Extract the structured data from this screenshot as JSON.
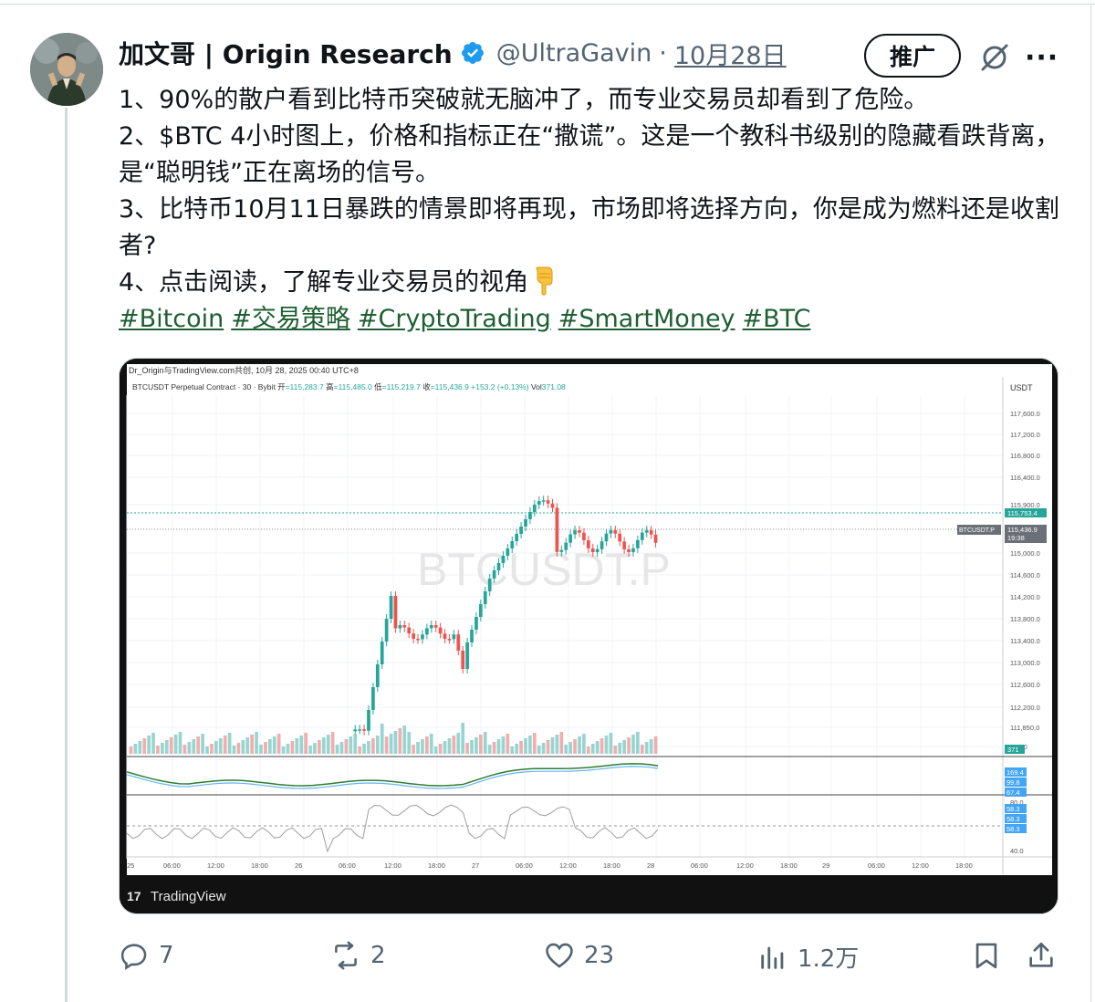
{
  "post": {
    "author_name": "加文哥 | Origin Research",
    "handle": "@UltraGavin",
    "separator": "·",
    "date": "10月28日",
    "promote_label": "推广",
    "lines": [
      "1、90%的散户看到比特币突破就无脑冲了，而专业交易员却看到了危险。",
      "2、$BTC 4小时图上，价格和指标正在“撒谎”。这是一个教科书级别的隐藏看跌背离，是“聪明钱”正在离场的信号。",
      "3、比特币10月11日暴跌的情景即将再现，市场即将选择方向，你是成为燃料还是收割者?",
      "4、点击阅读，了解专业交易员的视角"
    ],
    "hashtags": [
      "#Bitcoin",
      "#交易策略",
      "#CryptoTrading",
      "#SmartMoney",
      "#BTC"
    ]
  },
  "chart_image": {
    "top_caption": "Dr_Origin与TradingView.com共创, 10月 28, 2025 00:40 UTC+8",
    "symbol_line": "BTCUSDT Perpetual Contract · 30 · Bybit",
    "ohlc": {
      "open_label": "开",
      "open": "=115,283.7",
      "high_label": "高",
      "high": "=115,485.0",
      "low_label": "低",
      "low": "=115,219.7",
      "close_label": "收",
      "close": "=115,436.9",
      "change": "+153.2 (+0.13%)",
      "vol_label": "Vol",
      "vol": "371.08"
    },
    "currency": "USDT",
    "watermark": "BTCUSDT.P",
    "price_ticks": [
      "117,600.0",
      "117,200.0",
      "116,800.0",
      "116,400.0",
      "115,900.0",
      "115,000.0",
      "114,600.0",
      "114,200.0",
      "113,800.0",
      "113,400.0",
      "113,000.0",
      "112,600.0",
      "112,200.0",
      "111,850.0",
      "500.0"
    ],
    "price_label_high": "115,753.4",
    "price_label_symbol": "BTCUSDT.P",
    "price_label_last": "115,436.9",
    "price_label_countdown": "19:38",
    "vol_badge": "371",
    "macd_badges": [
      "169.4",
      "99.8",
      "67.4"
    ],
    "rsi_ticks": [
      "80.0",
      "40.0"
    ],
    "rsi_badges": [
      "58.3",
      "58.3",
      "58.3"
    ],
    "time_ticks": [
      "25",
      "06:00",
      "12:00",
      "18:00",
      "26",
      "06:00",
      "12:00",
      "18:00",
      "27",
      "06:00",
      "12:00",
      "18:00",
      "28",
      "06:00",
      "12:00",
      "18:00",
      "29",
      "06:00",
      "12:00",
      "18:00"
    ],
    "brand": "TradingView",
    "brand_logo": "17"
  },
  "actions": {
    "replies": "7",
    "reposts": "2",
    "likes": "23",
    "views": "1.2万"
  },
  "colors": {
    "up": "#26a69a",
    "down": "#ef5350",
    "hashtag": "#1f5f33",
    "verified": "#1d9bf0"
  }
}
